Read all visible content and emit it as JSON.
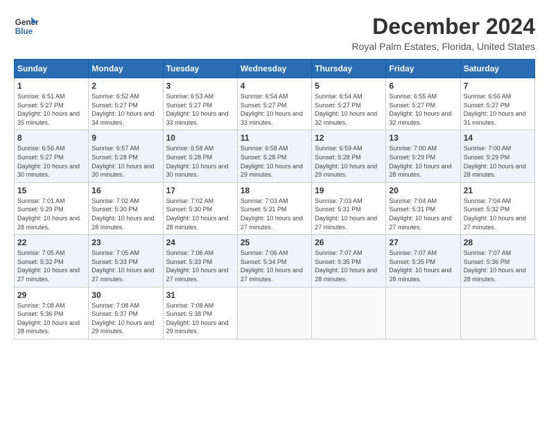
{
  "logo": {
    "line1": "General",
    "line2": "Blue"
  },
  "title": "December 2024",
  "location": "Royal Palm Estates, Florida, United States",
  "weekdays": [
    "Sunday",
    "Monday",
    "Tuesday",
    "Wednesday",
    "Thursday",
    "Friday",
    "Saturday"
  ],
  "weeks": [
    [
      {
        "day": "1",
        "sunrise": "6:51 AM",
        "sunset": "5:27 PM",
        "daylight": "10 hours and 35 minutes."
      },
      {
        "day": "2",
        "sunrise": "6:52 AM",
        "sunset": "5:27 PM",
        "daylight": "10 hours and 34 minutes."
      },
      {
        "day": "3",
        "sunrise": "6:53 AM",
        "sunset": "5:27 PM",
        "daylight": "10 hours and 33 minutes."
      },
      {
        "day": "4",
        "sunrise": "6:54 AM",
        "sunset": "5:27 PM",
        "daylight": "10 hours and 33 minutes."
      },
      {
        "day": "5",
        "sunrise": "6:54 AM",
        "sunset": "5:27 PM",
        "daylight": "10 hours and 32 minutes."
      },
      {
        "day": "6",
        "sunrise": "6:55 AM",
        "sunset": "5:27 PM",
        "daylight": "10 hours and 32 minutes."
      },
      {
        "day": "7",
        "sunrise": "6:56 AM",
        "sunset": "5:27 PM",
        "daylight": "10 hours and 31 minutes."
      }
    ],
    [
      {
        "day": "8",
        "sunrise": "6:56 AM",
        "sunset": "5:27 PM",
        "daylight": "10 hours and 30 minutes."
      },
      {
        "day": "9",
        "sunrise": "6:57 AM",
        "sunset": "5:28 PM",
        "daylight": "10 hours and 30 minutes."
      },
      {
        "day": "10",
        "sunrise": "6:58 AM",
        "sunset": "5:28 PM",
        "daylight": "10 hours and 30 minutes."
      },
      {
        "day": "11",
        "sunrise": "6:58 AM",
        "sunset": "5:28 PM",
        "daylight": "10 hours and 29 minutes."
      },
      {
        "day": "12",
        "sunrise": "6:59 AM",
        "sunset": "5:28 PM",
        "daylight": "10 hours and 29 minutes."
      },
      {
        "day": "13",
        "sunrise": "7:00 AM",
        "sunset": "5:29 PM",
        "daylight": "10 hours and 28 minutes."
      },
      {
        "day": "14",
        "sunrise": "7:00 AM",
        "sunset": "5:29 PM",
        "daylight": "10 hours and 28 minutes."
      }
    ],
    [
      {
        "day": "15",
        "sunrise": "7:01 AM",
        "sunset": "5:29 PM",
        "daylight": "10 hours and 28 minutes."
      },
      {
        "day": "16",
        "sunrise": "7:02 AM",
        "sunset": "5:30 PM",
        "daylight": "10 hours and 28 minutes."
      },
      {
        "day": "17",
        "sunrise": "7:02 AM",
        "sunset": "5:30 PM",
        "daylight": "10 hours and 28 minutes."
      },
      {
        "day": "18",
        "sunrise": "7:03 AM",
        "sunset": "5:31 PM",
        "daylight": "10 hours and 27 minutes."
      },
      {
        "day": "19",
        "sunrise": "7:03 AM",
        "sunset": "5:31 PM",
        "daylight": "10 hours and 27 minutes."
      },
      {
        "day": "20",
        "sunrise": "7:04 AM",
        "sunset": "5:31 PM",
        "daylight": "10 hours and 27 minutes."
      },
      {
        "day": "21",
        "sunrise": "7:04 AM",
        "sunset": "5:32 PM",
        "daylight": "10 hours and 27 minutes."
      }
    ],
    [
      {
        "day": "22",
        "sunrise": "7:05 AM",
        "sunset": "5:32 PM",
        "daylight": "10 hours and 27 minutes."
      },
      {
        "day": "23",
        "sunrise": "7:05 AM",
        "sunset": "5:33 PM",
        "daylight": "10 hours and 27 minutes."
      },
      {
        "day": "24",
        "sunrise": "7:06 AM",
        "sunset": "5:33 PM",
        "daylight": "10 hours and 27 minutes."
      },
      {
        "day": "25",
        "sunrise": "7:06 AM",
        "sunset": "5:34 PM",
        "daylight": "10 hours and 27 minutes."
      },
      {
        "day": "26",
        "sunrise": "7:07 AM",
        "sunset": "5:35 PM",
        "daylight": "10 hours and 28 minutes."
      },
      {
        "day": "27",
        "sunrise": "7:07 AM",
        "sunset": "5:35 PM",
        "daylight": "10 hours and 28 minutes."
      },
      {
        "day": "28",
        "sunrise": "7:07 AM",
        "sunset": "5:36 PM",
        "daylight": "10 hours and 28 minutes."
      }
    ],
    [
      {
        "day": "29",
        "sunrise": "7:08 AM",
        "sunset": "5:36 PM",
        "daylight": "10 hours and 28 minutes."
      },
      {
        "day": "30",
        "sunrise": "7:08 AM",
        "sunset": "5:37 PM",
        "daylight": "10 hours and 29 minutes."
      },
      {
        "day": "31",
        "sunrise": "7:08 AM",
        "sunset": "5:38 PM",
        "daylight": "10 hours and 29 minutes."
      },
      null,
      null,
      null,
      null
    ]
  ]
}
